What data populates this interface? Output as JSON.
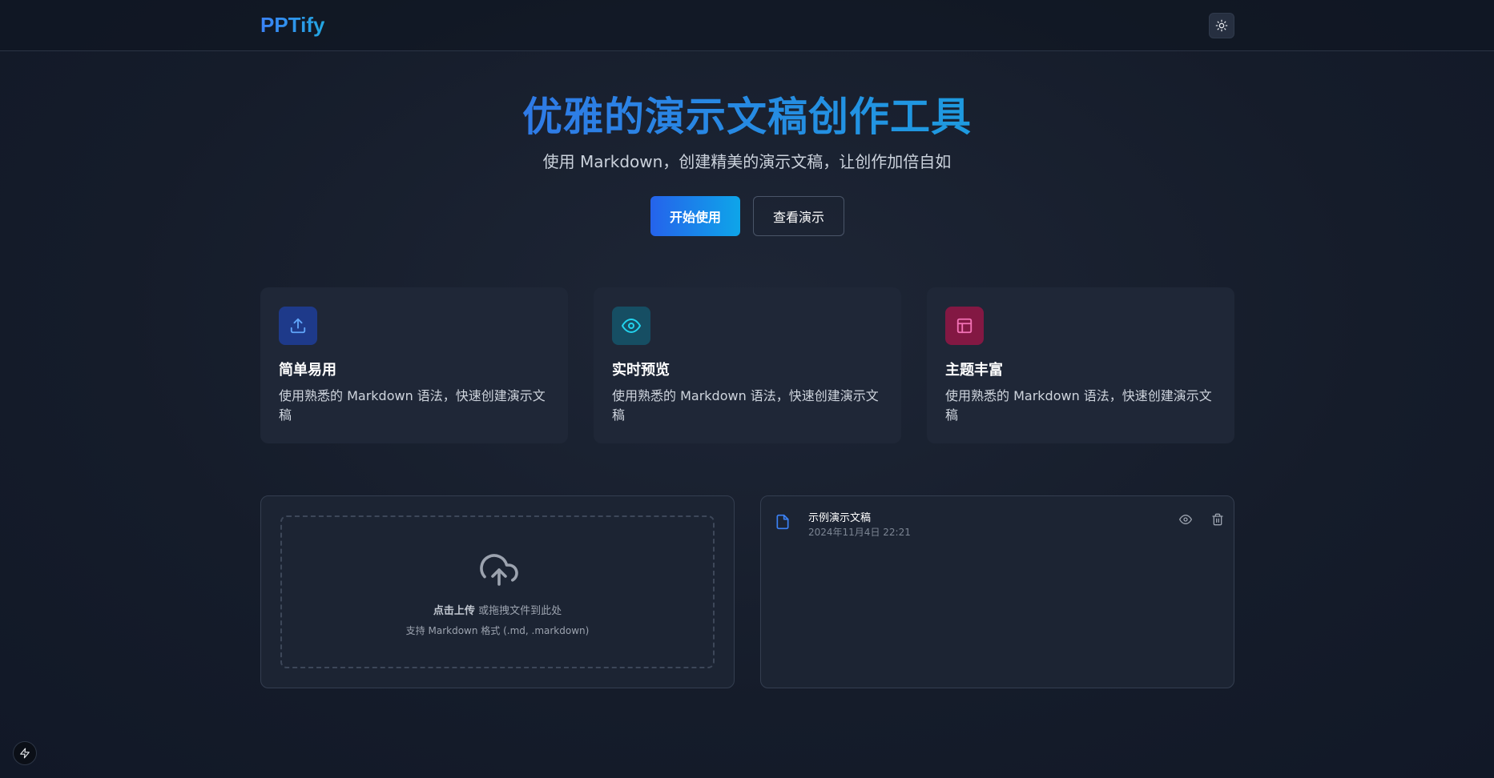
{
  "header": {
    "logo": "PPTify",
    "theme_toggle_icon": "sun-icon"
  },
  "hero": {
    "title": "优雅的演示文稿创作工具",
    "subtitle": "使用 Markdown，创建精美的演示文稿，让创作加倍自如",
    "primary_button": "开始使用",
    "secondary_button": "查看演示"
  },
  "features": [
    {
      "icon": "upload-icon",
      "icon_bg": "#1e3a8a",
      "icon_color": "#60a5fa",
      "title": "简单易用",
      "description": "使用熟悉的 Markdown 语法，快速创建演示文稿"
    },
    {
      "icon": "eye-icon",
      "icon_bg": "#164e63",
      "icon_color": "#22d3ee",
      "title": "实时预览",
      "description": "使用熟悉的 Markdown 语法，快速创建演示文稿"
    },
    {
      "icon": "layout-icon",
      "icon_bg": "#831843",
      "icon_color": "#f472b6",
      "title": "主题丰富",
      "description": "使用熟悉的 Markdown 语法，快速创建演示文稿"
    }
  ],
  "upload": {
    "icon": "cloud-upload-icon",
    "click_text": "点击上传",
    "drag_text": " 或拖拽文件到此处",
    "hint": "支持 Markdown 格式 (.md, .markdown)"
  },
  "files": [
    {
      "name": "示例演示文稿",
      "date": "2024年11月4日 22:21",
      "icon": "file-icon",
      "actions": [
        "eye-icon",
        "trash-icon"
      ]
    }
  ],
  "dev_indicator_icon": "lightning-icon",
  "colors": {
    "accent": "#2563eb",
    "accent_2": "#0ea5e9",
    "background": "#151c2a",
    "card": "#1f2737"
  }
}
